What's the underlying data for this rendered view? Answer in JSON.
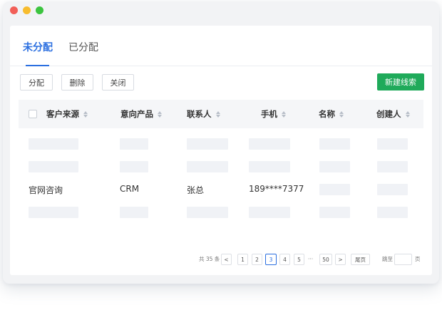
{
  "window": {
    "dots": [
      {
        "name": "close",
        "color": "#f25f58"
      },
      {
        "name": "minimize",
        "color": "#f7bc2e"
      },
      {
        "name": "zoom",
        "color": "#3cc43f"
      }
    ]
  },
  "tabs": {
    "unassigned": "未分配",
    "assigned": "已分配"
  },
  "toolbar": {
    "assign": "分配",
    "delete": "删除",
    "close": "关闭",
    "new_lead": "新建线索"
  },
  "table": {
    "columns": [
      "客户来源",
      "意向产品",
      "联系人",
      "手机",
      "名称",
      "创建人"
    ],
    "row": {
      "source": "官网咨询",
      "product": "CRM",
      "contact": "张总",
      "phone": "189****7377"
    }
  },
  "pagination": {
    "total": "共 35 条",
    "prev": "<",
    "pages": [
      "1",
      "2",
      "3",
      "4",
      "5"
    ],
    "current": "3",
    "ellipsis": "···",
    "last": "50",
    "next": ">",
    "confirm": "尾页",
    "jump_label": "跳至",
    "page_unit": "页"
  },
  "colors": {
    "accent": "#2b6fe0",
    "primary_button": "#1faa5a"
  }
}
